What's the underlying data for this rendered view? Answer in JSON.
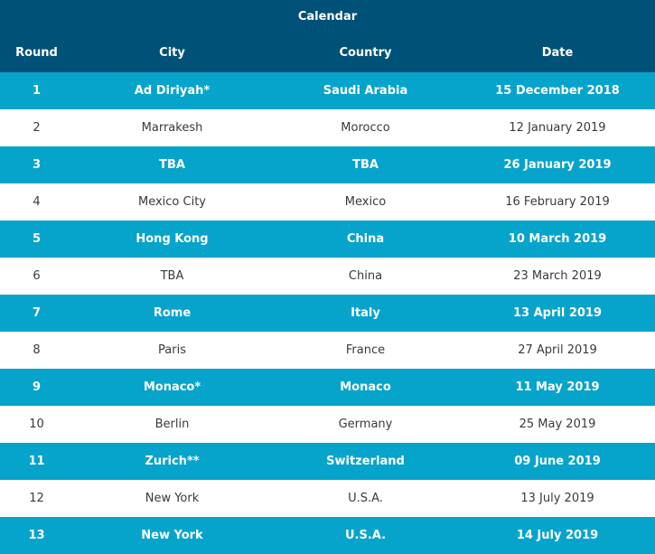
{
  "table": {
    "title": "Calendar",
    "headers": {
      "round": "Round",
      "city": "City",
      "country": "Country",
      "date": "Date"
    },
    "rows": [
      {
        "round": "1",
        "city": "Ad Diriyah*",
        "country": "Saudi Arabia",
        "date": "15 December 2018"
      },
      {
        "round": "2",
        "city": "Marrakesh",
        "country": "Morocco",
        "date": "12 January 2019"
      },
      {
        "round": "3",
        "city": "TBA",
        "country": "TBA",
        "date": "26 January 2019"
      },
      {
        "round": "4",
        "city": "Mexico City",
        "country": "Mexico",
        "date": "16 February 2019"
      },
      {
        "round": "5",
        "city": "Hong Kong",
        "country": "China",
        "date": "10 March 2019"
      },
      {
        "round": "6",
        "city": "TBA",
        "country": "China",
        "date": "23 March 2019"
      },
      {
        "round": "7",
        "city": "Rome",
        "country": "Italy",
        "date": "13 April 2019"
      },
      {
        "round": "8",
        "city": "Paris",
        "country": "France",
        "date": "27 April 2019"
      },
      {
        "round": "9",
        "city": "Monaco*",
        "country": "Monaco",
        "date": "11 May 2019"
      },
      {
        "round": "10",
        "city": "Berlin",
        "country": "Germany",
        "date": "25 May 2019"
      },
      {
        "round": "11",
        "city": "Zurich**",
        "country": "Switzerland",
        "date": "09 June 2019"
      },
      {
        "round": "12",
        "city": "New York",
        "country": "U.S.A.",
        "date": "13 July 2019"
      },
      {
        "round": "13",
        "city": "New York",
        "country": "U.S.A.",
        "date": "14 July 2019"
      }
    ]
  },
  "colors": {
    "header_bg": "#005177",
    "highlight_row_bg": "#06a4cb",
    "plain_row_bg": "#ffffff",
    "plain_row_text": "#3a3a3a"
  }
}
